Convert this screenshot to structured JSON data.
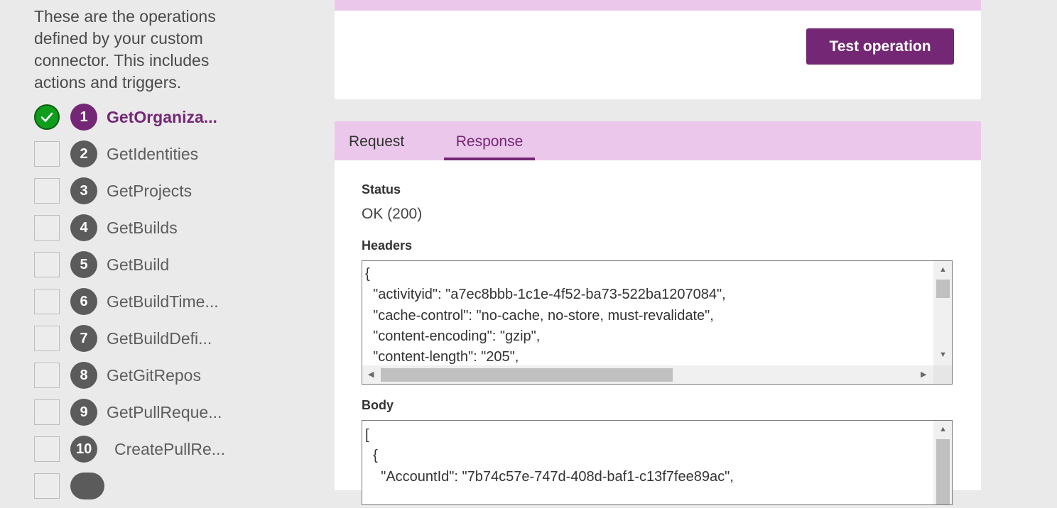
{
  "intro": "These are the operations defined by your custom connector. This includes actions and triggers.",
  "operations": [
    {
      "num": "1",
      "name": "GetOrganiza...",
      "done": true,
      "active": true
    },
    {
      "num": "2",
      "name": "GetIdentities"
    },
    {
      "num": "3",
      "name": "GetProjects"
    },
    {
      "num": "4",
      "name": "GetBuilds"
    },
    {
      "num": "5",
      "name": "GetBuild"
    },
    {
      "num": "6",
      "name": "GetBuildTime..."
    },
    {
      "num": "7",
      "name": "GetBuildDefi..."
    },
    {
      "num": "8",
      "name": "GetGitRepos"
    },
    {
      "num": "9",
      "name": "GetPullReque..."
    },
    {
      "num": "10",
      "name": "CreatePullRe..."
    }
  ],
  "top_card": {
    "test_button": "Test operation"
  },
  "tabs": {
    "request": "Request",
    "response": "Response",
    "active": "Response"
  },
  "response": {
    "status_label": "Status",
    "status_value": "OK (200)",
    "headers_label": "Headers",
    "headers_text": "{\n  \"activityid\": \"a7ec8bbb-1c1e-4f52-ba73-522ba1207084\",\n  \"cache-control\": \"no-cache, no-store, must-revalidate\",\n  \"content-encoding\": \"gzip\",\n  \"content-length\": \"205\",",
    "body_label": "Body",
    "body_text": "[\n  {\n    \"AccountId\": \"7b74c57e-747d-408d-baf1-c13f7fee89ac\","
  },
  "colors": {
    "accent": "#742774",
    "tab_band": "#ebc8eb",
    "success": "#0f9d1c"
  }
}
